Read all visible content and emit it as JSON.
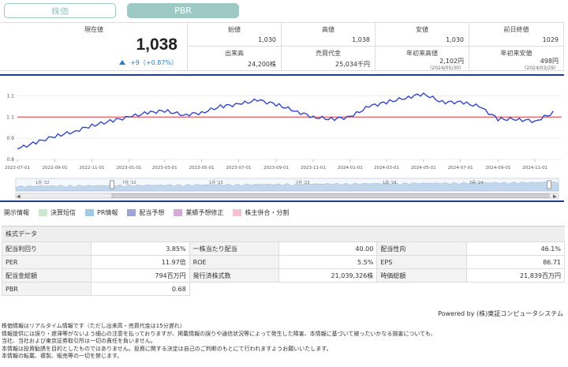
{
  "tabs": [
    {
      "label": "株価",
      "active": false
    },
    {
      "label": "PBR",
      "active": true
    }
  ],
  "quote": {
    "current_label": "現在値",
    "current_price": "1,038",
    "change": "+9（+0.87%）",
    "cells": [
      {
        "label": "始値",
        "value": "1,030"
      },
      {
        "label": "高値",
        "value": "1,038"
      },
      {
        "label": "安値",
        "value": "1,030"
      },
      {
        "label": "前日終値",
        "value": "1029"
      },
      {
        "label": "出来高",
        "value": "24,200株"
      },
      {
        "label": "売買代金",
        "value": "25,034千円"
      },
      {
        "label": "年初来高値",
        "value": "2,102円",
        "sub": "（2024/05/30）"
      },
      {
        "label": "年初来安値",
        "value": "498円",
        "sub": "（2024/03/29）"
      }
    ]
  },
  "chart_data": {
    "type": "line",
    "y_ticks": [
      "1.1",
      "1",
      "0.9",
      "0.8"
    ],
    "y_axis_marker": "1",
    "x_ticks": [
      "2022-07-01",
      "2022-09-01",
      "2022-11-01",
      "2023-01-01",
      "2023-03-01",
      "2023-05-01",
      "2023-07-01",
      "2023-09-01",
      "2023-11-01",
      "2024-01-01",
      "2024-03-01",
      "2024-05-01",
      "2024-07-01",
      "2024-09-01",
      "2024-11-01"
    ],
    "navigator_labels": [
      "1月 '22",
      "7月 '22",
      "1月 '23",
      "7月 '23",
      "1月 '24",
      "7月 '24"
    ],
    "reference_line": 1.0,
    "ylim": [
      0.8,
      1.15
    ],
    "series": [
      {
        "color": "#3346c8",
        "x": [
          "2022-07-01",
          "2022-08-01",
          "2022-09-01",
          "2022-10-01",
          "2022-11-01",
          "2022-12-01",
          "2023-01-01",
          "2023-02-01",
          "2023-03-01",
          "2023-04-01",
          "2023-05-01",
          "2023-06-01",
          "2023-07-01",
          "2023-08-01",
          "2023-09-01",
          "2023-10-01",
          "2023-11-01",
          "2023-12-01",
          "2024-01-01",
          "2024-02-01",
          "2024-03-01",
          "2024-04-01",
          "2024-05-01",
          "2024-06-01",
          "2024-07-01",
          "2024-08-01",
          "2024-09-01",
          "2024-10-01",
          "2024-11-01",
          "2024-12-01"
        ],
        "values": [
          0.85,
          0.88,
          0.91,
          0.93,
          0.96,
          0.98,
          1.0,
          1.02,
          1.03,
          1.01,
          1.02,
          1.05,
          1.06,
          1.08,
          1.06,
          1.03,
          1.0,
          0.99,
          1.0,
          1.05,
          1.07,
          1.09,
          1.11,
          1.07,
          1.07,
          1.05,
          0.99,
          0.99,
          0.98,
          1.02
        ]
      }
    ]
  },
  "legend": [
    {
      "label": "開示情報",
      "color": ""
    },
    {
      "label": "決算短信",
      "color": "#cce8cc"
    },
    {
      "label": "PR情報",
      "color": "#9fcbe6"
    },
    {
      "label": "配当予想",
      "color": "#9ea6d8"
    },
    {
      "label": "業績予想修正",
      "color": "#d7a9d8"
    },
    {
      "label": "株主併合・分割",
      "color": "#f5c0cf"
    }
  ],
  "stock_data": {
    "title": "株式データ",
    "rows": [
      [
        {
          "label": "配当利回り",
          "value": "3.85%"
        },
        {
          "label": "一株当たり配当",
          "value": "40.00"
        },
        {
          "label": "配当性向",
          "value": "46.1%"
        }
      ],
      [
        {
          "label": "PER",
          "value": "11.97倍"
        },
        {
          "label": "ROE",
          "value": "5.5%"
        },
        {
          "label": "EPS",
          "value": "86.71"
        }
      ],
      [
        {
          "label": "配当金総額",
          "value": "794百万円"
        },
        {
          "label": "発行済株式数",
          "value": "21,039,326株"
        },
        {
          "label": "時価総額",
          "value": "21,839百万円"
        }
      ],
      [
        {
          "label": "PBR",
          "value": "0.68"
        }
      ]
    ]
  },
  "powered_by": "Powered by (株)東証コンピュータシステム",
  "notes": [
    "株価情報はリアルタイム情報です（ただし出来高・売買代金は15分遅れ）",
    "情報提供には誤り・遅滞等がないよう細心の注意を払っておりますが、掲載情報の誤りや通信状況等によって発生した障害、本情報に基づいて被ったいかなる損害についても、",
    "当社、当社および東京証券取引所は一切の責任を負いません。",
    "本情報は投資勧誘を目的としたものではありません。投資に関する決定は自己のご判断のもとにて行われますようお願いいたします。",
    "本情報の転載、複製、販売等の一切を禁じます。"
  ]
}
